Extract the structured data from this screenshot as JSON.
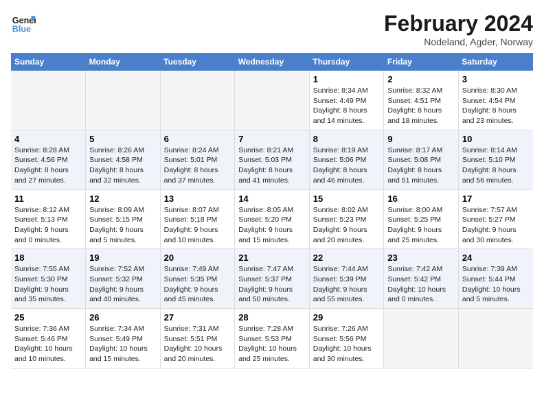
{
  "logo": {
    "line1": "General",
    "line2": "Blue"
  },
  "title": "February 2024",
  "subtitle": "Nodeland, Agder, Norway",
  "weekdays": [
    "Sunday",
    "Monday",
    "Tuesday",
    "Wednesday",
    "Thursday",
    "Friday",
    "Saturday"
  ],
  "weeks": [
    [
      {
        "day": "",
        "info": ""
      },
      {
        "day": "",
        "info": ""
      },
      {
        "day": "",
        "info": ""
      },
      {
        "day": "",
        "info": ""
      },
      {
        "day": "1",
        "info": "Sunrise: 8:34 AM\nSunset: 4:49 PM\nDaylight: 8 hours\nand 14 minutes."
      },
      {
        "day": "2",
        "info": "Sunrise: 8:32 AM\nSunset: 4:51 PM\nDaylight: 8 hours\nand 18 minutes."
      },
      {
        "day": "3",
        "info": "Sunrise: 8:30 AM\nSunset: 4:54 PM\nDaylight: 8 hours\nand 23 minutes."
      }
    ],
    [
      {
        "day": "4",
        "info": "Sunrise: 8:28 AM\nSunset: 4:56 PM\nDaylight: 8 hours\nand 27 minutes."
      },
      {
        "day": "5",
        "info": "Sunrise: 8:26 AM\nSunset: 4:58 PM\nDaylight: 8 hours\nand 32 minutes."
      },
      {
        "day": "6",
        "info": "Sunrise: 8:24 AM\nSunset: 5:01 PM\nDaylight: 8 hours\nand 37 minutes."
      },
      {
        "day": "7",
        "info": "Sunrise: 8:21 AM\nSunset: 5:03 PM\nDaylight: 8 hours\nand 41 minutes."
      },
      {
        "day": "8",
        "info": "Sunrise: 8:19 AM\nSunset: 5:06 PM\nDaylight: 8 hours\nand 46 minutes."
      },
      {
        "day": "9",
        "info": "Sunrise: 8:17 AM\nSunset: 5:08 PM\nDaylight: 8 hours\nand 51 minutes."
      },
      {
        "day": "10",
        "info": "Sunrise: 8:14 AM\nSunset: 5:10 PM\nDaylight: 8 hours\nand 56 minutes."
      }
    ],
    [
      {
        "day": "11",
        "info": "Sunrise: 8:12 AM\nSunset: 5:13 PM\nDaylight: 9 hours\nand 0 minutes."
      },
      {
        "day": "12",
        "info": "Sunrise: 8:09 AM\nSunset: 5:15 PM\nDaylight: 9 hours\nand 5 minutes."
      },
      {
        "day": "13",
        "info": "Sunrise: 8:07 AM\nSunset: 5:18 PM\nDaylight: 9 hours\nand 10 minutes."
      },
      {
        "day": "14",
        "info": "Sunrise: 8:05 AM\nSunset: 5:20 PM\nDaylight: 9 hours\nand 15 minutes."
      },
      {
        "day": "15",
        "info": "Sunrise: 8:02 AM\nSunset: 5:23 PM\nDaylight: 9 hours\nand 20 minutes."
      },
      {
        "day": "16",
        "info": "Sunrise: 8:00 AM\nSunset: 5:25 PM\nDaylight: 9 hours\nand 25 minutes."
      },
      {
        "day": "17",
        "info": "Sunrise: 7:57 AM\nSunset: 5:27 PM\nDaylight: 9 hours\nand 30 minutes."
      }
    ],
    [
      {
        "day": "18",
        "info": "Sunrise: 7:55 AM\nSunset: 5:30 PM\nDaylight: 9 hours\nand 35 minutes."
      },
      {
        "day": "19",
        "info": "Sunrise: 7:52 AM\nSunset: 5:32 PM\nDaylight: 9 hours\nand 40 minutes."
      },
      {
        "day": "20",
        "info": "Sunrise: 7:49 AM\nSunset: 5:35 PM\nDaylight: 9 hours\nand 45 minutes."
      },
      {
        "day": "21",
        "info": "Sunrise: 7:47 AM\nSunset: 5:37 PM\nDaylight: 9 hours\nand 50 minutes."
      },
      {
        "day": "22",
        "info": "Sunrise: 7:44 AM\nSunset: 5:39 PM\nDaylight: 9 hours\nand 55 minutes."
      },
      {
        "day": "23",
        "info": "Sunrise: 7:42 AM\nSunset: 5:42 PM\nDaylight: 10 hours\nand 0 minutes."
      },
      {
        "day": "24",
        "info": "Sunrise: 7:39 AM\nSunset: 5:44 PM\nDaylight: 10 hours\nand 5 minutes."
      }
    ],
    [
      {
        "day": "25",
        "info": "Sunrise: 7:36 AM\nSunset: 5:46 PM\nDaylight: 10 hours\nand 10 minutes."
      },
      {
        "day": "26",
        "info": "Sunrise: 7:34 AM\nSunset: 5:49 PM\nDaylight: 10 hours\nand 15 minutes."
      },
      {
        "day": "27",
        "info": "Sunrise: 7:31 AM\nSunset: 5:51 PM\nDaylight: 10 hours\nand 20 minutes."
      },
      {
        "day": "28",
        "info": "Sunrise: 7:28 AM\nSunset: 5:53 PM\nDaylight: 10 hours\nand 25 minutes."
      },
      {
        "day": "29",
        "info": "Sunrise: 7:26 AM\nSunset: 5:56 PM\nDaylight: 10 hours\nand 30 minutes."
      },
      {
        "day": "",
        "info": ""
      },
      {
        "day": "",
        "info": ""
      }
    ]
  ]
}
